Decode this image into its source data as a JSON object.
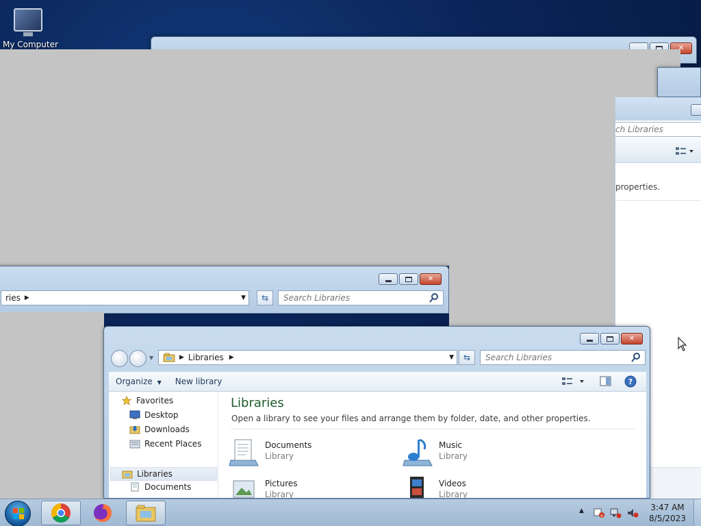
{
  "desktop": {
    "icon_label": "My Computer"
  },
  "back_window_mid": {
    "address_text": "ries",
    "search_placeholder": "Search Libraries"
  },
  "back_window_right": {
    "search_fragment": "ch Libraries",
    "text_fragment": "properties."
  },
  "explorer": {
    "address": {
      "crumbs": [
        "Libraries"
      ]
    },
    "search_placeholder": "Search Libraries",
    "toolbar": {
      "organize": "Organize",
      "new_library": "New library"
    },
    "nav": {
      "favorites": "Favorites",
      "desktop": "Desktop",
      "downloads": "Downloads",
      "recent_places": "Recent Places",
      "libraries": "Libraries",
      "documents": "Documents"
    },
    "content": {
      "title": "Libraries",
      "subtitle": "Open a library to see your files and arrange them by folder, date, and other properties.",
      "items": [
        {
          "name": "Documents",
          "type": "Library"
        },
        {
          "name": "Music",
          "type": "Library"
        },
        {
          "name": "Pictures",
          "type": "Library"
        },
        {
          "name": "Videos",
          "type": "Library"
        }
      ]
    }
  },
  "taskbar": {
    "time": "3:47 AM",
    "date": "8/5/2023",
    "apps": [
      "chrome-icon",
      "firefox-icon",
      "file-explorer-icon"
    ]
  }
}
